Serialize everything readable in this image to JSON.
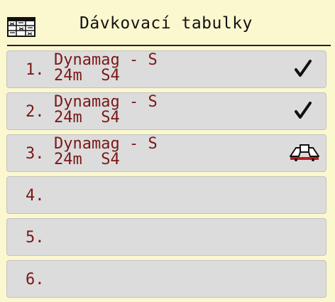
{
  "header": {
    "title": "Dávkovací tabulky",
    "icon": "fertilizer-table-icon"
  },
  "rows": [
    {
      "number": "1.",
      "name": "Dynamag - S",
      "spec": "24m  S4",
      "status": "check"
    },
    {
      "number": "2.",
      "name": "Dynamag - S",
      "spec": "24m  S4",
      "status": "check"
    },
    {
      "number": "3.",
      "name": "Dynamag - S",
      "spec": "24m  S4",
      "status": "active-spreader"
    },
    {
      "number": "4.",
      "name": "",
      "spec": "",
      "status": ""
    },
    {
      "number": "5.",
      "name": "",
      "spec": "",
      "status": ""
    },
    {
      "number": "6.",
      "name": "",
      "spec": "",
      "status": ""
    }
  ],
  "colors": {
    "background": "#fbf7cf",
    "row": "#dcdcdc",
    "text": "#7a1818"
  }
}
